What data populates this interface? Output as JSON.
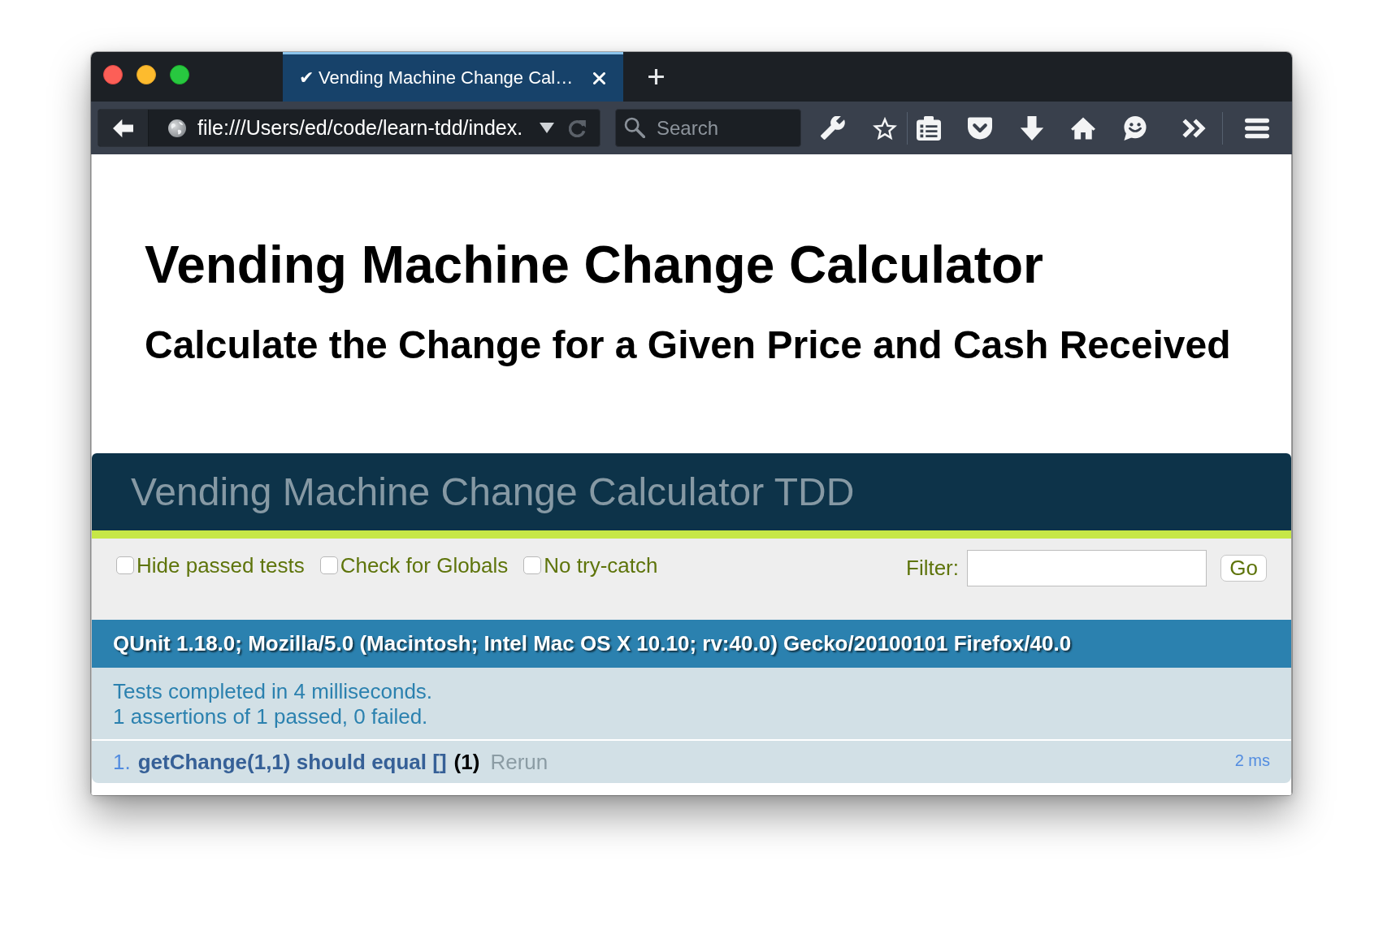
{
  "window": {
    "controls": [
      {
        "kind": "close"
      },
      {
        "kind": "minimize"
      },
      {
        "kind": "maximize"
      }
    ]
  },
  "tabs": [
    {
      "title": "✔ Vending Machine Change Cal…",
      "selected": true
    }
  ],
  "navigation": {
    "url": "file:///Users/ed/code/learn-tdd/index.",
    "search_placeholder": "Search"
  },
  "page": {
    "title": "Vending Machine Change Calculator",
    "subtitle": "Calculate the Change for a Given Price and Cash Received"
  },
  "qunit": {
    "header": "Vending Machine Change Calculator TDD",
    "passed": true,
    "options": [
      {
        "label": "Hide passed tests",
        "checked": false
      },
      {
        "label": "Check for Globals",
        "checked": false
      },
      {
        "label": "No try-catch",
        "checked": false
      }
    ],
    "filter": {
      "label": "Filter:",
      "button": "Go"
    },
    "user_agent": "QUnit 1.18.0; Mozilla/5.0 (Macintosh; Intel Mac OS X 10.10; rv:40.0) Gecko/20100101 Firefox/40.0",
    "summary": [
      "Tests completed in 4 milliseconds.",
      "1 assertions of 1 passed, 0 failed."
    ],
    "tests": [
      {
        "number": "1.",
        "name": "getChange(1,1) should equal []",
        "counts": "(1)",
        "rerun": "Rerun",
        "runtime": "2 ms",
        "passed": true
      }
    ]
  }
}
